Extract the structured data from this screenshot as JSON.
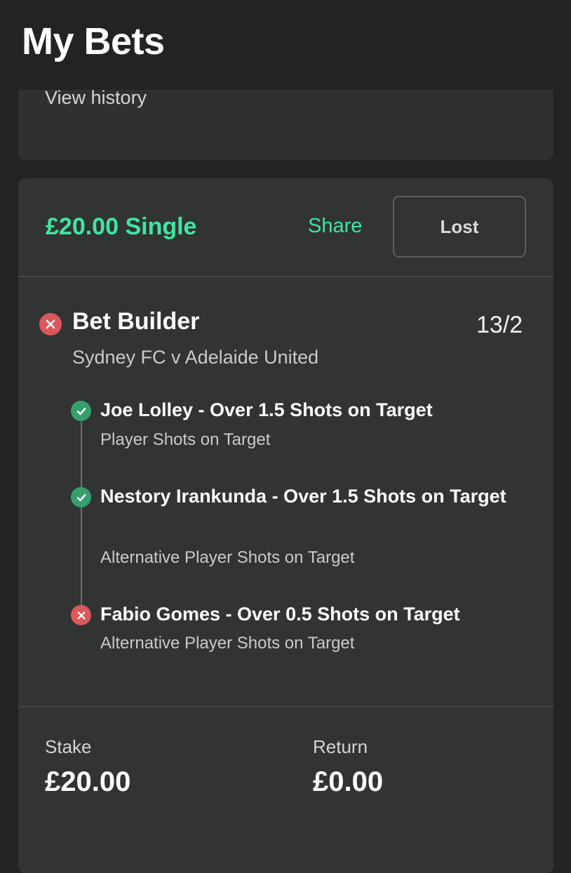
{
  "header": {
    "title": "My Bets"
  },
  "history": {
    "link_label": "View history"
  },
  "bet": {
    "amount_label": "£20.00 Single",
    "share_label": "Share",
    "status_label": "Lost",
    "builder": {
      "title": "Bet Builder",
      "odds": "13/2",
      "match": "Sydney FC v Adelaide United",
      "result_icon": "cross-icon"
    },
    "legs": [
      {
        "title": "Joe Lolley - Over 1.5 Shots on Target",
        "market": "Player Shots on Target",
        "result": "won",
        "icon": "check-icon"
      },
      {
        "title": "Nestory Irankunda - Over 1.5 Shots on Target",
        "market": "Alternative Player Shots on Target",
        "result": "won",
        "icon": "check-icon"
      },
      {
        "title": "Fabio Gomes - Over 0.5 Shots on Target",
        "market": "Alternative Player Shots on Target",
        "result": "lost",
        "icon": "cross-icon"
      }
    ],
    "summary": {
      "stake_label": "Stake",
      "stake_value": "£20.00",
      "return_label": "Return",
      "return_value": "£0.00"
    }
  },
  "colors": {
    "accent_green": "#3fe6a3",
    "won_green": "#35a06b",
    "lost_red": "#d9585c",
    "card_background": "#313433",
    "page_background": "#232323"
  }
}
